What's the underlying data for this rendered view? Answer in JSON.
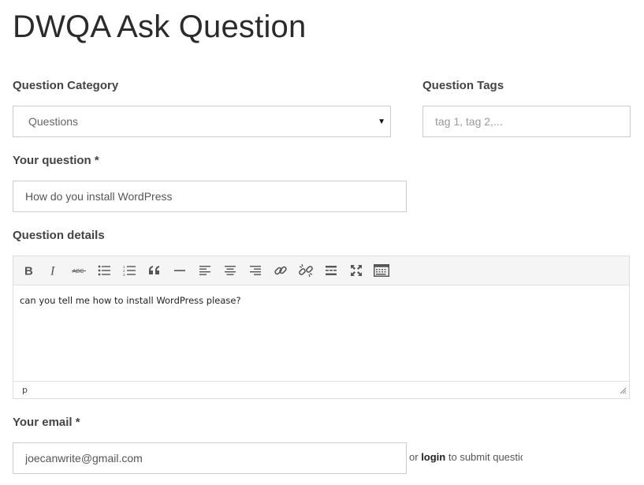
{
  "page": {
    "title": "DWQA Ask Question"
  },
  "category": {
    "label": "Question Category",
    "selected": "Questions"
  },
  "tags": {
    "label": "Question Tags",
    "placeholder": "tag 1, tag 2,..."
  },
  "question": {
    "label": "Your question *",
    "value": "How do you install WordPress"
  },
  "details": {
    "label": "Question details",
    "toolbar": [
      "bold-icon",
      "italic-icon",
      "strikethrough-icon",
      "bullet-list-icon",
      "numbered-list-icon",
      "blockquote-icon",
      "horizontal-rule-icon",
      "align-left-icon",
      "align-center-icon",
      "align-right-icon",
      "link-icon",
      "unlink-icon",
      "read-more-icon",
      "fullscreen-icon",
      "toolbar-toggle-icon"
    ],
    "content": "can you tell me how to install WordPress please?",
    "path": "p"
  },
  "email": {
    "label": "Your email *",
    "value": "joecanwrite@gmail.com",
    "or_text": "or",
    "login_link": "login",
    "after_text": "to submit questio"
  },
  "colors": {
    "border": "#cccccc",
    "toolbar_bg": "#f5f5f5",
    "icon": "#555555",
    "label": "#444444"
  }
}
